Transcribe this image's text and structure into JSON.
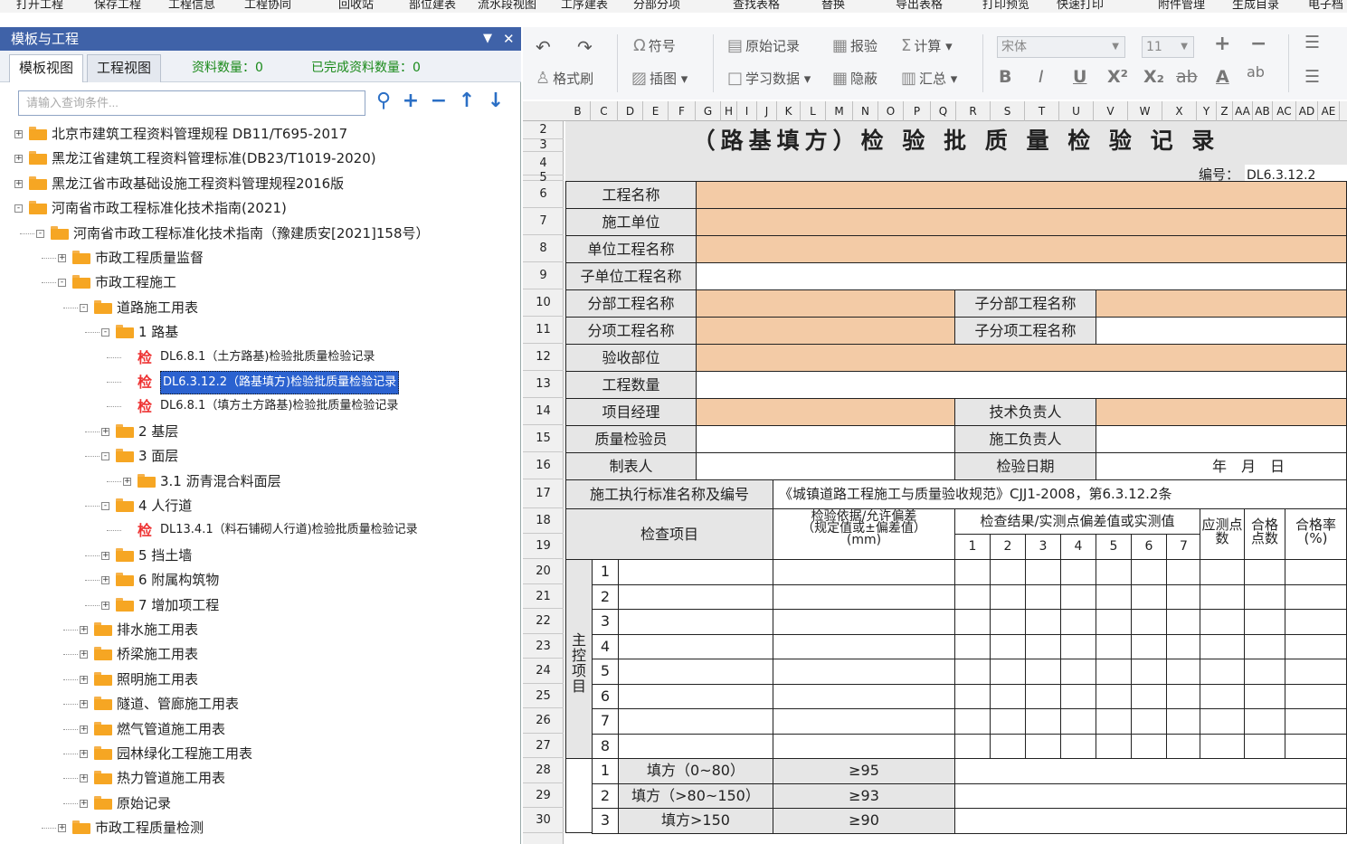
{
  "top_menu": [
    "打开工程",
    "保存工程",
    "工程信息",
    "工程协同",
    "回收站",
    "部位建表",
    "流水段视图",
    "工序建表",
    "分部分项",
    "查找表格",
    "替换",
    "导出表格",
    "打印预览",
    "快速打印",
    "附件管理",
    "生成目录",
    "电子档"
  ],
  "left_panel": {
    "title": "模板与工程",
    "pin_icon": "pin-icon",
    "close_icon": "close-icon",
    "tabs": [
      "模板视图",
      "工程视图"
    ],
    "stat_count": "资料数量：0",
    "stat_done": "已完成资料数量：0",
    "search_placeholder": "请输入查询条件..."
  },
  "tree": [
    {
      "label": "北京市建筑工程资料管理规程 DB11/T695-2017",
      "level": 0,
      "type": "folder",
      "expand": "+"
    },
    {
      "label": "黑龙江省建筑工程资料管理标准(DB23/T1019-2020)",
      "level": 0,
      "type": "folder",
      "expand": "+"
    },
    {
      "label": "黑龙江省市政基础设施工程资料管理规程2016版",
      "level": 0,
      "type": "folder",
      "expand": "+"
    },
    {
      "label": "河南省市政工程标准化技术指南(2021)",
      "level": 0,
      "type": "folder",
      "expand": "-"
    },
    {
      "label": "河南省市政工程标准化技术指南（豫建质安[2021]158号）",
      "level": 1,
      "type": "folder",
      "expand": "-"
    },
    {
      "label": "市政工程质量监督",
      "level": 2,
      "type": "folder",
      "expand": "+"
    },
    {
      "label": "市政工程施工",
      "level": 2,
      "type": "folder",
      "expand": "-"
    },
    {
      "label": "道路施工用表",
      "level": 3,
      "type": "folder",
      "expand": "-"
    },
    {
      "label": "1 路基",
      "level": 4,
      "type": "folder",
      "expand": "-"
    },
    {
      "label": "DL6.8.1（土方路基)检验批质量检验记录",
      "level": 5,
      "type": "doc",
      "expand": ""
    },
    {
      "label": "DL6.3.12.2（路基填方)检验批质量检验记录",
      "level": 5,
      "type": "doc",
      "expand": "",
      "selected": true
    },
    {
      "label": "DL6.8.1（填方土方路基)检验批质量检验记录",
      "level": 5,
      "type": "doc",
      "expand": ""
    },
    {
      "label": "2 基层",
      "level": 4,
      "type": "folder",
      "expand": "+"
    },
    {
      "label": "3 面层",
      "level": 4,
      "type": "folder",
      "expand": "-"
    },
    {
      "label": "3.1 沥青混合料面层",
      "level": 5,
      "type": "folder",
      "expand": "+"
    },
    {
      "label": "4 人行道",
      "level": 4,
      "type": "folder",
      "expand": "-"
    },
    {
      "label": "DL13.4.1（料石铺砌人行道)检验批质量检验记录",
      "level": 5,
      "type": "doc",
      "expand": ""
    },
    {
      "label": "5 挡土墙",
      "level": 4,
      "type": "folder",
      "expand": "+"
    },
    {
      "label": "6 附属构筑物",
      "level": 4,
      "type": "folder",
      "expand": "+"
    },
    {
      "label": "7 增加项工程",
      "level": 4,
      "type": "folder",
      "expand": "+"
    },
    {
      "label": "排水施工用表",
      "level": 3,
      "type": "folder",
      "expand": "+"
    },
    {
      "label": "桥梁施工用表",
      "level": 3,
      "type": "folder",
      "expand": "+"
    },
    {
      "label": "照明施工用表",
      "level": 3,
      "type": "folder",
      "expand": "+"
    },
    {
      "label": "隧道、管廊施工用表",
      "level": 3,
      "type": "folder",
      "expand": "+"
    },
    {
      "label": "燃气管道施工用表",
      "level": 3,
      "type": "folder",
      "expand": "+"
    },
    {
      "label": "园林绿化工程施工用表",
      "level": 3,
      "type": "folder",
      "expand": "+"
    },
    {
      "label": "热力管道施工用表",
      "level": 3,
      "type": "folder",
      "expand": "+"
    },
    {
      "label": "原始记录",
      "level": 3,
      "type": "folder",
      "expand": "+"
    },
    {
      "label": "市政工程质量检测",
      "level": 2,
      "type": "folder",
      "expand": "+"
    }
  ],
  "toolbar": {
    "symbol": "符号",
    "original": "原始记录",
    "report": "报验",
    "calc": "计算",
    "format_brush": "格式刷",
    "insert_image": "插图",
    "study_data": "学习数据",
    "hide": "隐蔽",
    "summary": "汇总",
    "font_name": "宋体",
    "font_size": "11",
    "bold": "B",
    "italic": "I",
    "underline": "U",
    "sup": "X²",
    "sub": "X₂",
    "strike": "ab",
    "color": "A",
    "phonetic": "ab"
  },
  "columns": [
    "B",
    "C",
    "D",
    "E",
    "F",
    "G",
    "H",
    "I",
    "J",
    "K",
    "L",
    "M",
    "N",
    "O",
    "P",
    "Q",
    "R",
    "S",
    "T",
    "U",
    "V",
    "W",
    "X",
    "Y",
    "Z",
    "AA",
    "AB",
    "AC",
    "AD",
    "AE"
  ],
  "rows": [
    "2",
    "3",
    "4",
    "5",
    "6",
    "7",
    "8",
    "9",
    "10",
    "11",
    "12",
    "13",
    "14",
    "15",
    "16",
    "17",
    "18",
    "19",
    "20",
    "21",
    "22",
    "23",
    "24",
    "25",
    "26",
    "27",
    "28",
    "29",
    "30"
  ],
  "form": {
    "title": "（路基填方）检 验 批 质 量 检 验 记 录",
    "code_label": "编号：",
    "code_value": "DL6.3.12.2",
    "project_name": "工程名称",
    "construction_unit": "施工单位",
    "unit_project": "单位工程名称",
    "sub_unit_project": "子单位工程名称",
    "division": "分部工程名称",
    "sub_division": "子分部工程名称",
    "item": "分项工程名称",
    "sub_item": "子分项工程名称",
    "accept_part": "验收部位",
    "quantity": "工程数量",
    "pm": "项目经理",
    "tech_lead": "技术负责人",
    "qc": "质量检验员",
    "construction_lead": "施工负责人",
    "tabulator": "制表人",
    "inspect_date": "检验日期",
    "date_value": "年　月　日",
    "standard_label": "施工执行标准名称及编号",
    "standard_value": "《城镇道路工程施工与质量验收规范》CJJ1-2008，第6.3.12.2条",
    "check_item": "检查项目",
    "basis": "检验依据/允许偏差",
    "basis2": "（规定值或±偏差值）",
    "basis3": "(mm)",
    "result": "检查结果/实测点偏差值或实测值",
    "points": "应测点数",
    "pass_points": "合格点数",
    "pass_rate": "合格率(%)",
    "main_control": "主控项目",
    "result_nums": [
      "1",
      "2",
      "3",
      "4",
      "5",
      "6",
      "7"
    ],
    "main_nums": [
      "1",
      "2",
      "3",
      "4",
      "5",
      "6",
      "7",
      "8"
    ],
    "fill_rows": [
      {
        "n": "1",
        "item": "填方（0~80）",
        "value": "≥95"
      },
      {
        "n": "2",
        "item": "填方（>80~150）",
        "value": "≥93"
      },
      {
        "n": "3",
        "item": "填方>150",
        "value": "≥90"
      }
    ]
  },
  "colors": {
    "title_bar": "#3f62a8",
    "orange_cell": "#f3cba6",
    "gray_cell": "#e6e6e6",
    "select": "#2b62d0",
    "stat_green": "#1a8a1a"
  }
}
